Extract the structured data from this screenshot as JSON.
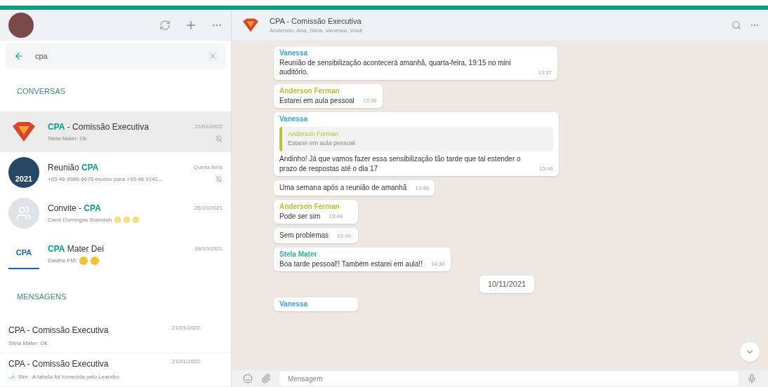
{
  "search": {
    "value": "cpa"
  },
  "conversations_heading": "CONVERSAS",
  "conversations": [
    {
      "avatar": {
        "kind": "logo"
      },
      "name": "**CPA** - Comissão Executiva",
      "preview": "Stela Mater: Ok",
      "date": "21/01/2022",
      "muted": true,
      "selected": true
    },
    {
      "avatar": {
        "kind": "photo",
        "text": "2021"
      },
      "name": "Reunião **CPA**",
      "preview": "+55 46 9986-6075 mudou para +55 46 9141...",
      "date": "Quinta-feira",
      "muted": true,
      "selected": false
    },
    {
      "avatar": {
        "kind": "group"
      },
      "name": "Convite - **CPA**",
      "preview": "Carol Domingos Suenash",
      "date": "26/10/2021",
      "muted": false,
      "selected": false,
      "emojis": [
        {
          "kind": "clap"
        },
        {
          "kind": "clap"
        },
        {
          "kind": "clap"
        }
      ]
    },
    {
      "avatar": {
        "kind": "text",
        "text": "CPA"
      },
      "name": "**CPA** Mater Dei",
      "preview": "Daiane FM:",
      "date": "19/10/2021",
      "muted": false,
      "selected": false,
      "emojis": [
        {
          "kind": "laugh"
        },
        {
          "kind": "laugh"
        }
      ]
    }
  ],
  "messages_heading": "MENSAGENS",
  "messages": [
    {
      "name": "CPA - Comissão Executiva",
      "preview": "Stela Mater: Ok",
      "date": "21/01/2022",
      "ticks": false
    },
    {
      "name": "CPA - Comissão Executiva",
      "preview": "Sim . A tabela foi fornecida pelo Leandro",
      "date": "21/01/2022",
      "ticks": true
    }
  ],
  "chat": {
    "title": "CPA - Comissão Executiva",
    "subtitle": "Anderson, Ana, Stela, Vanessa, Você",
    "input_placeholder": "Mensagem"
  },
  "chat_items": [
    {
      "kind": "message",
      "sender": "Vanessa",
      "color": "#35a6d6",
      "text": "Reunião de sensibilização acontecerá amanhã, quarta-feira, 19:15 no mini auditório.",
      "time": "13:37"
    },
    {
      "kind": "message",
      "sender": "Anderson Ferman",
      "color": "#b7c23a",
      "text": "Estarei em aula pessoal",
      "time": "13:39"
    },
    {
      "kind": "message",
      "sender": "Vanessa",
      "color": "#35a6d6",
      "quote": {
        "sender": "Anderson Ferman",
        "text": "Estarei em aula pessoal"
      },
      "text": "Andinho! Já que vamos fazer essa sensibilização tão tarde que tal estender o prazo de respostas até o dia 17",
      "time": "13:46"
    },
    {
      "kind": "message",
      "text": "Uma semana após a reunião de amanhã",
      "time": "13:46"
    },
    {
      "kind": "message",
      "sender": "Anderson Ferman",
      "color": "#b7c23a",
      "text": "Pode ser sim",
      "time": "13:48"
    },
    {
      "kind": "message",
      "text": "Sem problemas",
      "time": "13:49"
    },
    {
      "kind": "message",
      "sender": "Stela Mater",
      "color": "#2fb58f",
      "text": "Boa tarde pessoal!! Também estarei em aula!!",
      "time": "14:34"
    },
    {
      "kind": "date",
      "text": "10/11/2021"
    },
    {
      "kind": "message",
      "sender": "Vanessa",
      "color": "#35a6d6"
    }
  ]
}
